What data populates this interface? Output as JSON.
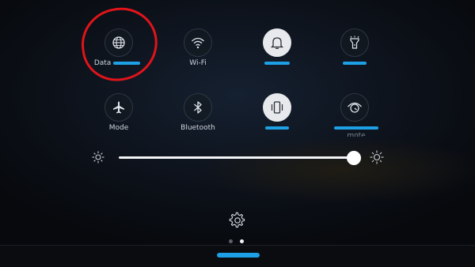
{
  "tiles": [
    {
      "label": "Data",
      "sublabel": "",
      "icon": "globe-icon",
      "active": false
    },
    {
      "label": "Wi-Fi",
      "sublabel": "",
      "icon": "wifi-icon",
      "active": false
    },
    {
      "label": "",
      "sublabel": "",
      "icon": "bell-icon",
      "active": true
    },
    {
      "label": "",
      "sublabel": "",
      "icon": "flashlight-icon",
      "active": false
    },
    {
      "label": "Mode",
      "sublabel": "",
      "icon": "airplane-icon",
      "active": false
    },
    {
      "label": "Bluetooth",
      "sublabel": "",
      "icon": "bluetooth-icon",
      "active": false
    },
    {
      "label": "",
      "sublabel": "",
      "icon": "vibrate-icon",
      "active": true
    },
    {
      "label": "",
      "sublabel": "mote",
      "icon": "eye-icon",
      "active": false
    }
  ],
  "brightness": {
    "level": 0.97
  },
  "pager": {
    "pages": 2,
    "current": 2
  },
  "colors": {
    "highlight_ring": "#e0141a",
    "redaction": "#1ea0e6",
    "track": "#f2f4f6"
  }
}
